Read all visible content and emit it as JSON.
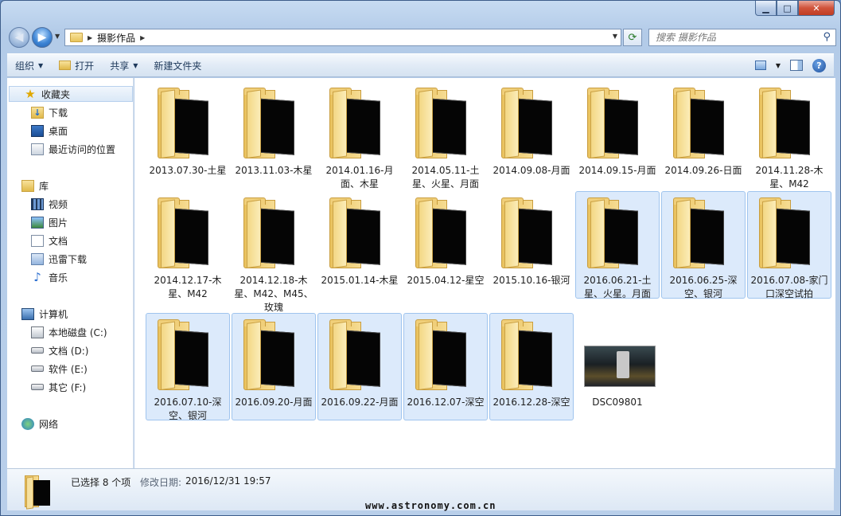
{
  "window": {
    "caption_minimize": "▁",
    "caption_maximize": "□",
    "caption_close": "✕"
  },
  "address_bar": {
    "path": [
      "摄影作品"
    ]
  },
  "search": {
    "placeholder": "搜索 摄影作品"
  },
  "toolbar": {
    "organize": "组织",
    "open": "打开",
    "share": "共享",
    "new_folder": "新建文件夹"
  },
  "nav_pane": {
    "favorites": {
      "label": "收藏夹",
      "items": [
        "下载",
        "桌面",
        "最近访问的位置"
      ]
    },
    "libraries": {
      "label": "库",
      "items": [
        "视频",
        "图片",
        "文档",
        "迅雷下载",
        "音乐"
      ]
    },
    "computer": {
      "label": "计算机",
      "items": [
        "本地磁盘 (C:)",
        "文档 (D:)",
        "软件 (E:)",
        "其它 (F:)"
      ]
    },
    "network": {
      "label": "网络"
    }
  },
  "items": [
    {
      "label": "2013.07.30-土星",
      "selected": false
    },
    {
      "label": "2013.11.03-木星",
      "selected": false
    },
    {
      "label": "2014.01.16-月面、木星",
      "selected": false
    },
    {
      "label": "2014.05.11-土星、火星、月面",
      "selected": false
    },
    {
      "label": "2014.09.08-月面",
      "selected": false
    },
    {
      "label": "2014.09.15-月面",
      "selected": false
    },
    {
      "label": "2014.09.26-日面",
      "selected": false
    },
    {
      "label": "2014.11.28-木星、M42",
      "selected": false
    },
    {
      "label": "2014.12.17-木星、M42",
      "selected": false
    },
    {
      "label": "2014.12.18-木星、M42、M45、玫瑰",
      "selected": false
    },
    {
      "label": "2015.01.14-木星",
      "selected": false
    },
    {
      "label": "2015.04.12-星空",
      "selected": false
    },
    {
      "label": "2015.10.16-银河",
      "selected": false
    },
    {
      "label": "2016.06.21-土星、火星。月面",
      "selected": true
    },
    {
      "label": "2016.06.25-深空、银河",
      "selected": true
    },
    {
      "label": "2016.07.08-家门口深空试拍",
      "selected": true
    },
    {
      "label": "2016.07.10-深空、银河",
      "selected": true
    },
    {
      "label": "2016.09.20-月面",
      "selected": true
    },
    {
      "label": "2016.09.22-月面",
      "selected": true
    },
    {
      "label": "2016.12.07-深空",
      "selected": true
    },
    {
      "label": "2016.12.28-深空",
      "selected": true
    },
    {
      "label": "DSC09801",
      "selected": false
    }
  ],
  "details": {
    "selection": "已选择 8 个项",
    "modified_key": "修改日期:",
    "modified_value": "2016/12/31 19:57"
  },
  "watermark": "www.astronomy.com.cn"
}
